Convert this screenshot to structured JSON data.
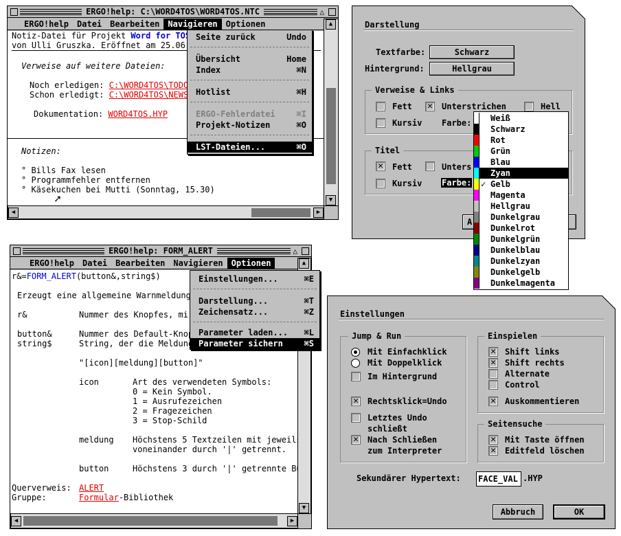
{
  "win1": {
    "title": "ERGO!help: C:\\WORD4TOS\\WORD4TOS.NTC",
    "menu": [
      "ERGO!help",
      "Datei",
      "Bearbeiten",
      "Navigieren",
      "Optionen"
    ],
    "lines": {
      "l1a": "Notiz-Datei für Projekt ",
      "l1b": "Word for TOS",
      "l2": "von Ulli Gruszka. Eröffnet am 25.06.",
      "l3": "Verweise auf weitere Dateien:",
      "l4a": "Noch erledigen: ",
      "l4b": "C:\\WORD4TOS\\TODO",
      "l5a": "Schon erledigt: ",
      "l5b": "C:\\WORD4TOS\\NEWS",
      "l6a": "Dokumentation: ",
      "l6b": "WORD4TOS.HYP",
      "l7": "Notizen:",
      "l8": "° Bills Fax lesen",
      "l9": "° Programmfehler entfernen",
      "l10": "° Käsekuchen bei Mutti (Sonntag, 15.30)"
    },
    "dropdown": [
      {
        "label": "Seite zurück",
        "key": "Undo"
      },
      {
        "label": "Übersicht",
        "key": "Home"
      },
      {
        "label": "Index",
        "key": "⌘N"
      },
      {
        "label": "Hotlist",
        "key": "⌘H"
      },
      {
        "label": "ERGO-Fehlerdatei",
        "key": "⌘I"
      },
      {
        "label": "Projekt-Notizen",
        "key": "⌘O"
      },
      {
        "label": "LST-Dateien...",
        "key": "⌘O"
      }
    ]
  },
  "win2": {
    "title": "ERGO!help: FORM_ALERT",
    "menu": [
      "ERGO!help",
      "Datei",
      "Bearbeiten",
      "Navigieren",
      "Optionen"
    ],
    "lines": {
      "a1": "r&=",
      "a2": "FORM_ALERT",
      "a3": "(button&,string$)",
      "b": "Erzeugt eine allgemeine Warnmeldung",
      "c1": "r&",
      "c2": "Nummer des Knopfes, mi",
      "d1": "button&",
      "d2": "Nummer des Default-Knop",
      "e1": "string$",
      "e2": "String, der die Meldung",
      "f": "\"[icon][meldung][button]\"",
      "g1": "icon",
      "g2": "Art des verwendeten Symbols:",
      "h": "0 = Kein Symbol.",
      "i": "1 = Ausrufezeichen",
      "j": "2 = Fragezeichen",
      "k": "3 = Stop-Schild",
      "m1": "meldung",
      "m2": "Höchstens 5 Textzeilen mit jeweils",
      "m3": "voneinander durch '|' getrennt.",
      "n1": "button",
      "n2": "Höchstens 3 durch '|' getrennte Bu",
      "o1": "Querverweis:",
      "o2": "ALERT",
      "p1": "Gruppe:",
      "p2": "Formular",
      "p3": "-Bibliothek"
    },
    "dropdown": [
      {
        "label": "Einstellungen...",
        "key": "⌘E"
      },
      {
        "label": "Darstellung...",
        "key": "⌘T"
      },
      {
        "label": "Zeichensatz...",
        "key": "⌘Z"
      },
      {
        "label": "Parameter laden...",
        "key": "⌘L"
      },
      {
        "label": "Parameter sichern",
        "key": "⌘S"
      }
    ]
  },
  "dlg1": {
    "title": "Darstellung",
    "textfarbe_label": "Textfarbe:",
    "textfarbe": "Schwarz",
    "hintergrund_label": "Hintergrund:",
    "hintergrund": "Hellgrau",
    "group1": "Verweise & Links",
    "fett": "Fett",
    "unterstrichen": "Unterstrichen",
    "hell": "Hell",
    "kursiv": "Kursiv",
    "farbe": "Farbe:",
    "group2": "Titel",
    "fett2": "Fett",
    "unters2": "Unters",
    "kursiv2": "Kursiv",
    "farbe2": "Farbe:",
    "btn_a": "A"
  },
  "colors": [
    {
      "name": "Weiß",
      "hex": "#ffffff"
    },
    {
      "name": "Schwarz",
      "hex": "#000000"
    },
    {
      "name": "Rot",
      "hex": "#ff0000"
    },
    {
      "name": "Grün",
      "hex": "#00cc00"
    },
    {
      "name": "Blau",
      "hex": "#0000ff"
    },
    {
      "name": "Zyan",
      "hex": "#00ffff"
    },
    {
      "name": "Gelb",
      "hex": "#ffff00"
    },
    {
      "name": "Magenta",
      "hex": "#ff00ff"
    },
    {
      "name": "Hellgrau",
      "hex": "#c0c0c0"
    },
    {
      "name": "Dunkelgrau",
      "hex": "#808080"
    },
    {
      "name": "Dunkelrot",
      "hex": "#880000"
    },
    {
      "name": "Dunkelgrün",
      "hex": "#008800"
    },
    {
      "name": "Dunkelblau",
      "hex": "#000088"
    },
    {
      "name": "Dunkelzyan",
      "hex": "#008888"
    },
    {
      "name": "Dunkelgelb",
      "hex": "#888800"
    },
    {
      "name": "Dunkelmagenta",
      "hex": "#880088"
    }
  ],
  "dlg2": {
    "title": "Einstellungen",
    "jump": "Jump & Run",
    "r1": "Mit Einfachklick",
    "r2": "Mit Doppelklick",
    "c1": "Im Hintergrund",
    "c2": "Rechtsklick=Undo",
    "c3a": "Letztes Undo",
    "c3b": "schließt",
    "c4a": "Nach Schließen",
    "c4b": "zum Interpreter",
    "einspielen": "Einspielen",
    "e1": "Shift links",
    "e2": "Shift rechts",
    "e3": "Alternate",
    "e4": "Control",
    "e5": "Auskommentieren",
    "seitensuche": "Seitensuche",
    "s1": "Mit Taste öffnen",
    "s2": "Editfeld löschen",
    "sek_label": "Sekundärer Hypertext:",
    "sek_value": "FACE_VAL",
    "sek_ext": ".HYP",
    "abbruch": "Abbruch",
    "ok": "OK"
  }
}
